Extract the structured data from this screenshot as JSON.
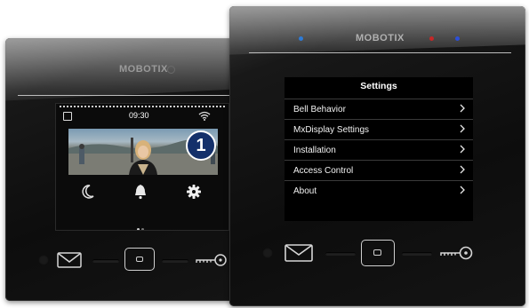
{
  "left_panel": {
    "brand": "MOBOTIX",
    "screen": {
      "time": "09:30",
      "badge_number": "1",
      "status_icons": [
        "gallery-icon",
        "wifi-icon"
      ],
      "actions": [
        "moon-icon",
        "bell-icon",
        "gear-icon"
      ],
      "page_indicator": {
        "count": 2,
        "active": 0
      }
    },
    "buttons": [
      "envelope-icon",
      "home-button-icon",
      "key-icon"
    ]
  },
  "right_panel": {
    "brand": "MOBOTIX",
    "leds": {
      "left": "#2e7bd6",
      "middle": "#c62828",
      "right": "#2c4fd8"
    },
    "menu": {
      "title": "Settings",
      "items": [
        {
          "label": "Bell Behavior"
        },
        {
          "label": "MxDisplay Settings"
        },
        {
          "label": "Installation"
        },
        {
          "label": "Access Control"
        },
        {
          "label": "About"
        }
      ]
    },
    "buttons": [
      "envelope-icon",
      "home-button-icon",
      "key-icon"
    ]
  },
  "colors": {
    "device_body": "#111111",
    "badge_fill": "#14306a",
    "icon_stroke": "#d6d6d6"
  }
}
